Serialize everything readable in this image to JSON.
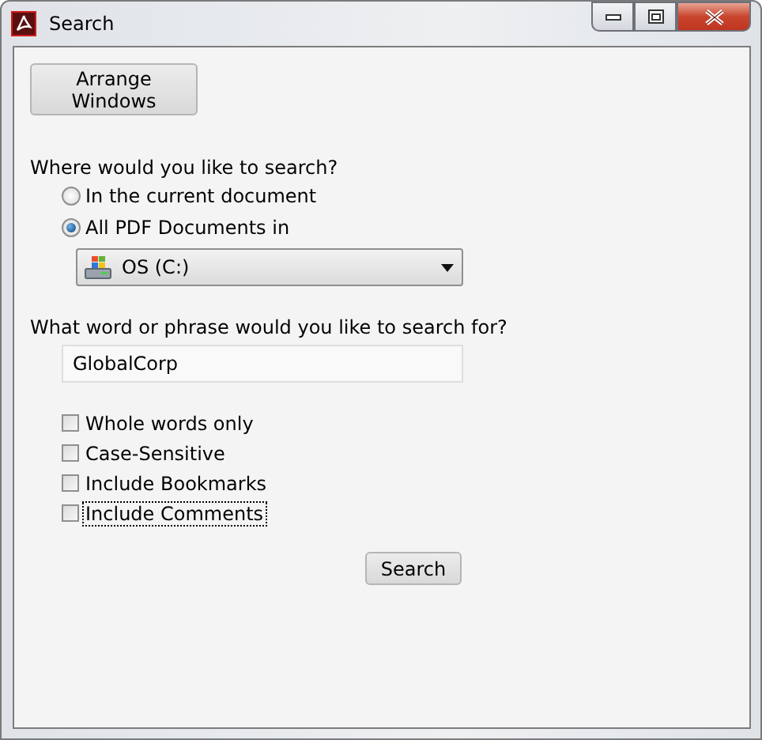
{
  "window": {
    "title": "Search"
  },
  "arrange_button": {
    "label": "Arrange Windows"
  },
  "location": {
    "label": "Where would you like to search?",
    "options": [
      {
        "label": "In the current document",
        "selected": false
      },
      {
        "label": "All PDF Documents in",
        "selected": true
      }
    ],
    "drive": {
      "value": "OS (C:)"
    }
  },
  "query": {
    "label": "What word or phrase would you like to search for?",
    "value": "GlobalCorp"
  },
  "options": [
    {
      "label": "Whole words only",
      "checked": false,
      "focused": false
    },
    {
      "label": "Case-Sensitive",
      "checked": false,
      "focused": false
    },
    {
      "label": "Include Bookmarks",
      "checked": false,
      "focused": false
    },
    {
      "label": "Include Comments",
      "checked": false,
      "focused": true
    }
  ],
  "search_button": {
    "label": "Search"
  }
}
